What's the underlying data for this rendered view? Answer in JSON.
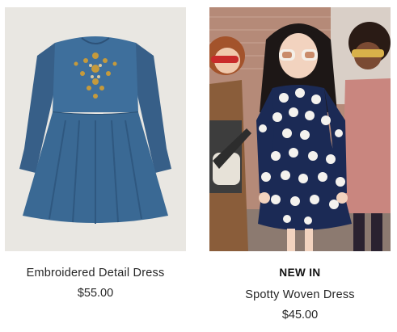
{
  "products": [
    {
      "name": "Embroidered Detail Dress",
      "price": "$55.00",
      "badge": "",
      "image": "denim-dress-photo",
      "colors": {
        "background": "#e9e7e2",
        "dress": "#3b6a95",
        "embroidery": "#c59a3c"
      }
    },
    {
      "name": "Spotty Woven Dress",
      "price": "$45.00",
      "badge": "NEW IN",
      "image": "kids-spotty-dress-photo",
      "colors": {
        "background": "#b9a39a",
        "dress": "#1b2a55",
        "dots": "#f4f2ee"
      }
    }
  ]
}
